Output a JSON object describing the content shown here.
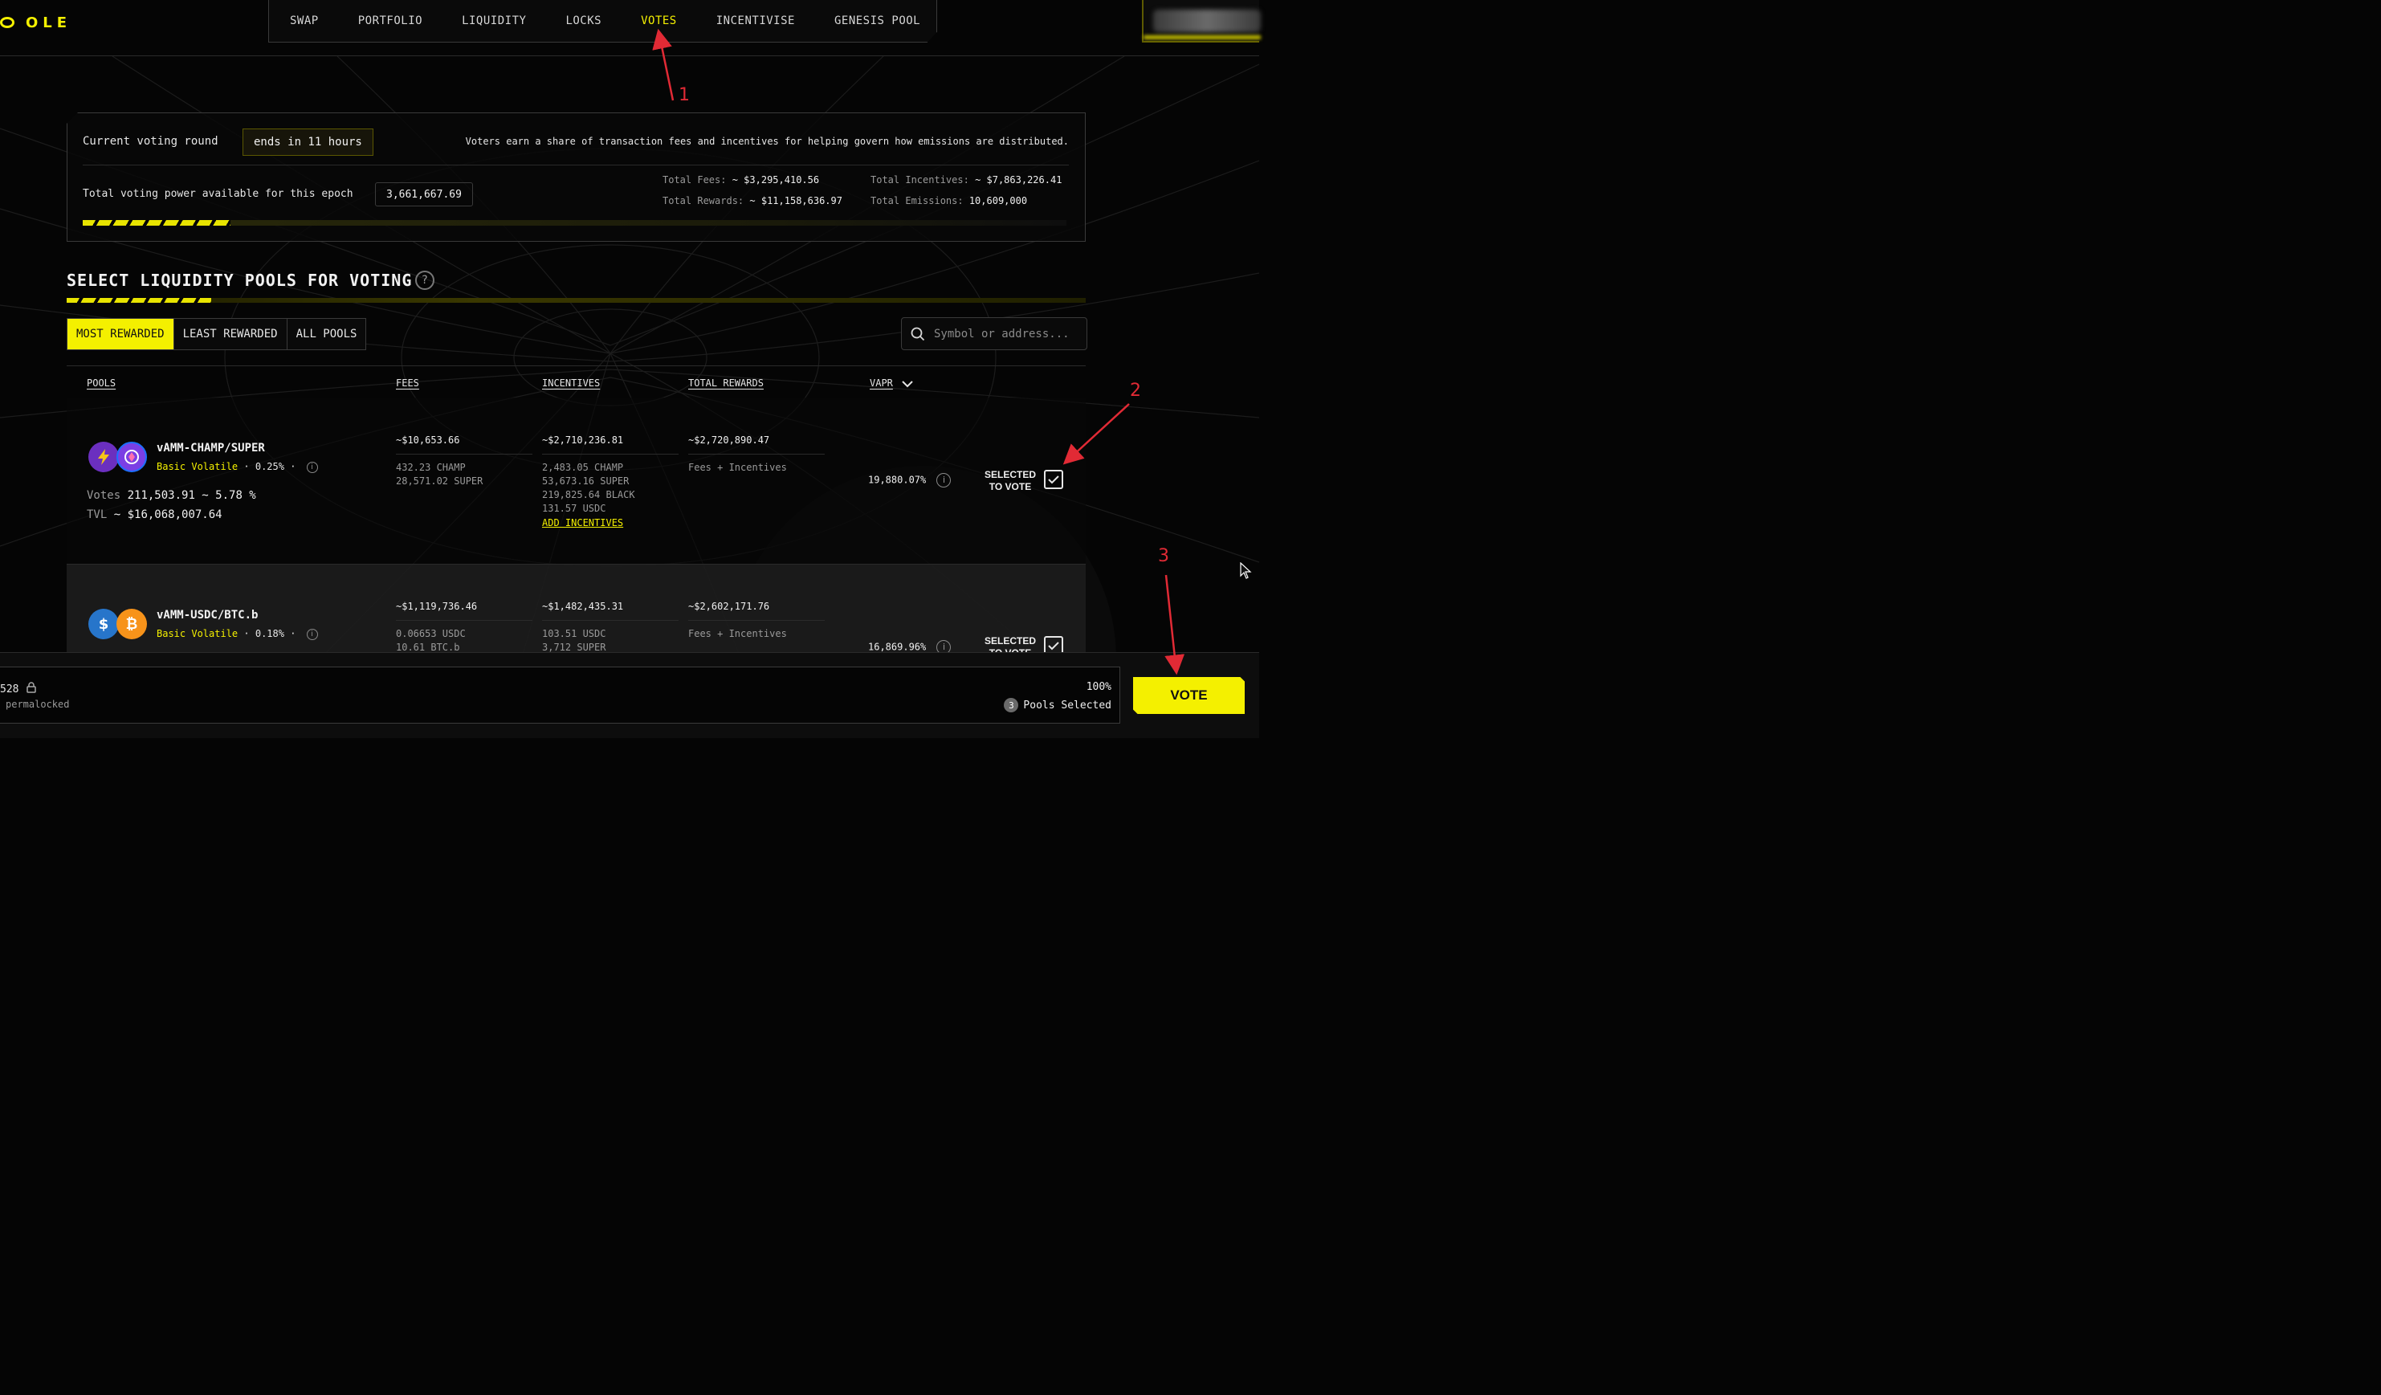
{
  "app": {
    "logo_text": "OLE"
  },
  "nav": {
    "items": [
      "SWAP",
      "PORTFOLIO",
      "LIQUIDITY",
      "LOCKS",
      "VOTES",
      "INCENTIVISE",
      "GENESIS POOL"
    ],
    "active": "VOTES"
  },
  "annotations": [
    "1",
    "2",
    "3"
  ],
  "round": {
    "label": "Current voting round",
    "ends": "ends in 11 hours",
    "info": "Voters earn a share of transaction fees and incentives for helping govern how emissions are distributed.",
    "power_label": "Total voting power available for this epoch",
    "power_value": "3,661,667.69",
    "total_fees_label": "Total Fees:",
    "total_fees_value": "~ $3,295,410.56",
    "total_rewards_label": "Total Rewards:",
    "total_rewards_value": "~ $11,158,636.97",
    "total_incentives_label": "Total Incentives:",
    "total_incentives_value": "~ $7,863,226.41",
    "total_emissions_label": "Total Emissions:",
    "total_emissions_value": "10,609,000",
    "progress": 0.15
  },
  "section": {
    "title": "SELECT LIQUIDITY POOLS FOR VOTING",
    "help": "?"
  },
  "filters": {
    "tabs": [
      "MOST REWARDED",
      "LEAST REWARDED",
      "ALL POOLS"
    ],
    "active": "MOST REWARDED"
  },
  "search": {
    "placeholder": "Symbol or address..."
  },
  "table": {
    "headers": {
      "pools": "POOLS",
      "fees": "FEES",
      "incentives": "INCENTIVES",
      "total_rewards": "TOTAL REWARDS",
      "vapr": "VAPR"
    },
    "rows": [
      {
        "name": "vAMM-CHAMP/SUPER",
        "type": "Basic Volatile",
        "fee": "· 0.25% ·",
        "votes_label": "Votes",
        "votes": "211,503.91 ~ 5.78 %",
        "tvl_label": "TVL",
        "tvl": "~ $16,068,007.64",
        "fees_total": "~$10,653.66",
        "fees_breakdown": [
          "432.23 CHAMP",
          "28,571.02 SUPER"
        ],
        "incentives_total": "~$2,710,236.81",
        "incentives_breakdown": [
          "2,483.05 CHAMP",
          "53,673.16 SUPER",
          "219,825.64 BLACK",
          "131.57 USDC"
        ],
        "add_incentives": "ADD INCENTIVES",
        "rewards_total": "~$2,720,890.47",
        "rewards_note": "Fees + Incentives",
        "vapr": "19,880.07%",
        "selected_label_1": "SELECTED",
        "selected_label_2": "TO VOTE"
      },
      {
        "name": "vAMM-USDC/BTC.b",
        "type": "Basic Volatile",
        "fee": "· 0.18% ·",
        "fees_total": "~$1,119,736.46",
        "fees_breakdown": [
          "0.06653 USDC",
          "10.61 BTC.b"
        ],
        "incentives_total": "~$1,482,435.31",
        "incentives_breakdown": [
          "103.51 USDC",
          "3,712 SUPER"
        ],
        "rewards_total": "~$2,602,171.76",
        "rewards_note": "Fees + Incentives",
        "vapr": "16,869.96%",
        "selected_label_1": "SELECTED",
        "selected_label_2": "TO VOTE"
      }
    ]
  },
  "bottom": {
    "lock_value": "528",
    "lock_note": "permalocked",
    "percent": "100%",
    "pools_count": "3",
    "pools_selected": "Pools Selected",
    "vote_label": "VOTE"
  },
  "colors": {
    "accent": "#f4f000",
    "annotation": "#e12a35",
    "background": "#050505"
  }
}
